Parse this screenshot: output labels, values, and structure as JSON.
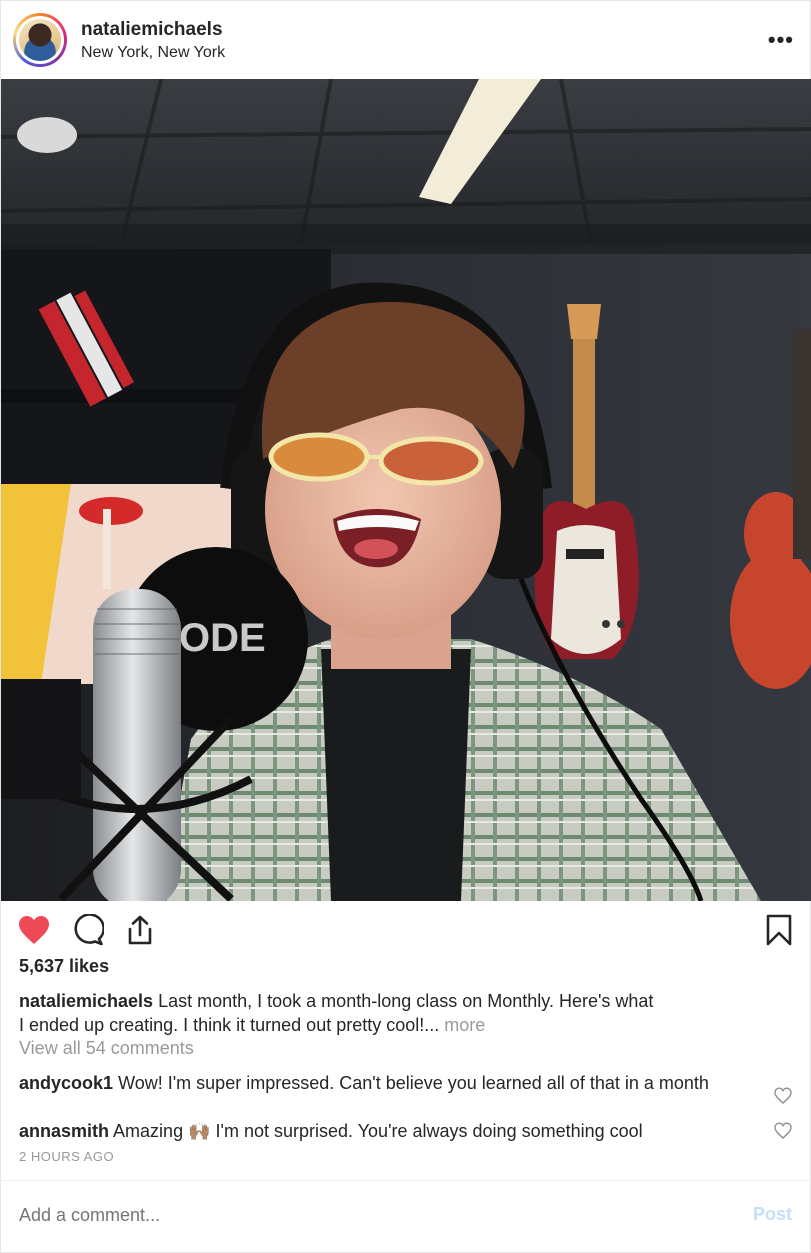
{
  "header": {
    "username": "nataliemichaels",
    "location": "New York, New York",
    "more_icon": "more-dots-icon"
  },
  "photo": {
    "mic_brand": "ODE"
  },
  "actions": {
    "like_icon": "heart-filled-icon",
    "like_color": "#ed4956",
    "comment_icon": "comment-bubble-icon",
    "share_icon": "share-icon",
    "save_icon": "bookmark-icon"
  },
  "likes": "5,637 likes",
  "caption": {
    "username": "nataliemichaels",
    "line1": "Last month, I took a month-long class on Monthly. Here's what",
    "line2": "I ended up creating. I think it turned out pretty cool!...",
    "more": "more"
  },
  "view_all": "View all 54 comments",
  "comments": [
    {
      "username": "andycook1",
      "text": "Wow! I'm super impressed. Can't believe you learned all of that in a month"
    },
    {
      "username": "annasmith",
      "text_before": "Amazing",
      "emoji": "🙌🏽",
      "text_after": "I'm not surprised. You're always doing something cool"
    }
  ],
  "timestamp": "2 HOURS AGO",
  "add_comment": {
    "placeholder": "Add a comment..."
  },
  "post_button": "Post"
}
